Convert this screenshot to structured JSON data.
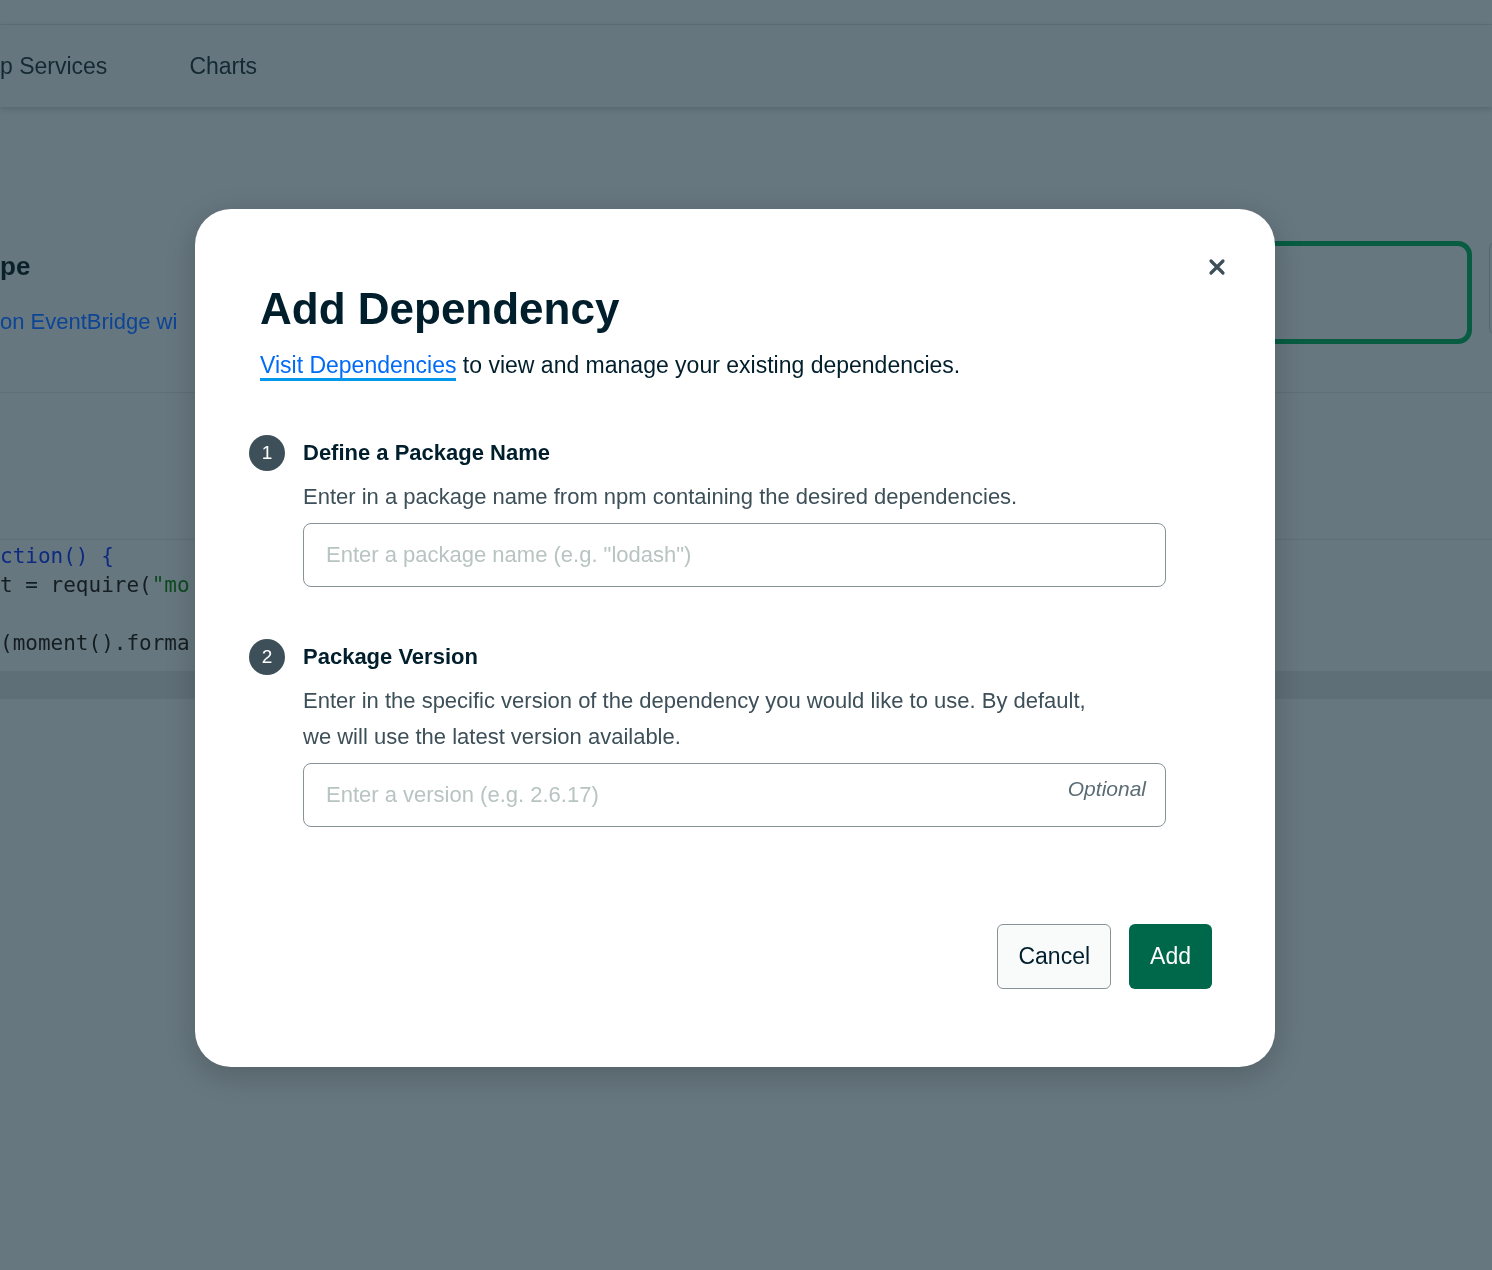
{
  "nav": {
    "tabs": [
      {
        "label": "p Services"
      },
      {
        "label": "Charts"
      }
    ]
  },
  "background": {
    "heading": "pe",
    "link": "on EventBridge wi",
    "code_lines": [
      {
        "kind": "fn",
        "text": "ction() {"
      },
      {
        "kind": "require",
        "prefix": "t = require(",
        "string": "\"mo"
      },
      {
        "kind": "plain",
        "text": "(moment().forma"
      }
    ]
  },
  "dialog": {
    "title": "Add Dependency",
    "intro_link": "Visit Dependencies",
    "intro_text": " to view and manage your existing dependencies.",
    "steps": [
      {
        "number": "1",
        "title": "Define a Package Name",
        "description": "Enter in a package name from npm containing the desired dependencies.",
        "placeholder": "Enter a package name (e.g. \"lodash\")"
      },
      {
        "number": "2",
        "title": "Package Version",
        "description": "Enter in the specific version of the dependency you would like to use. By default, we will use the latest version available.",
        "placeholder": "Enter a version (e.g. 2.6.17)",
        "hint": "Optional"
      }
    ],
    "buttons": [
      {
        "kind": "secondary",
        "label": "Cancel"
      },
      {
        "kind": "primary",
        "label": "Add"
      }
    ]
  }
}
